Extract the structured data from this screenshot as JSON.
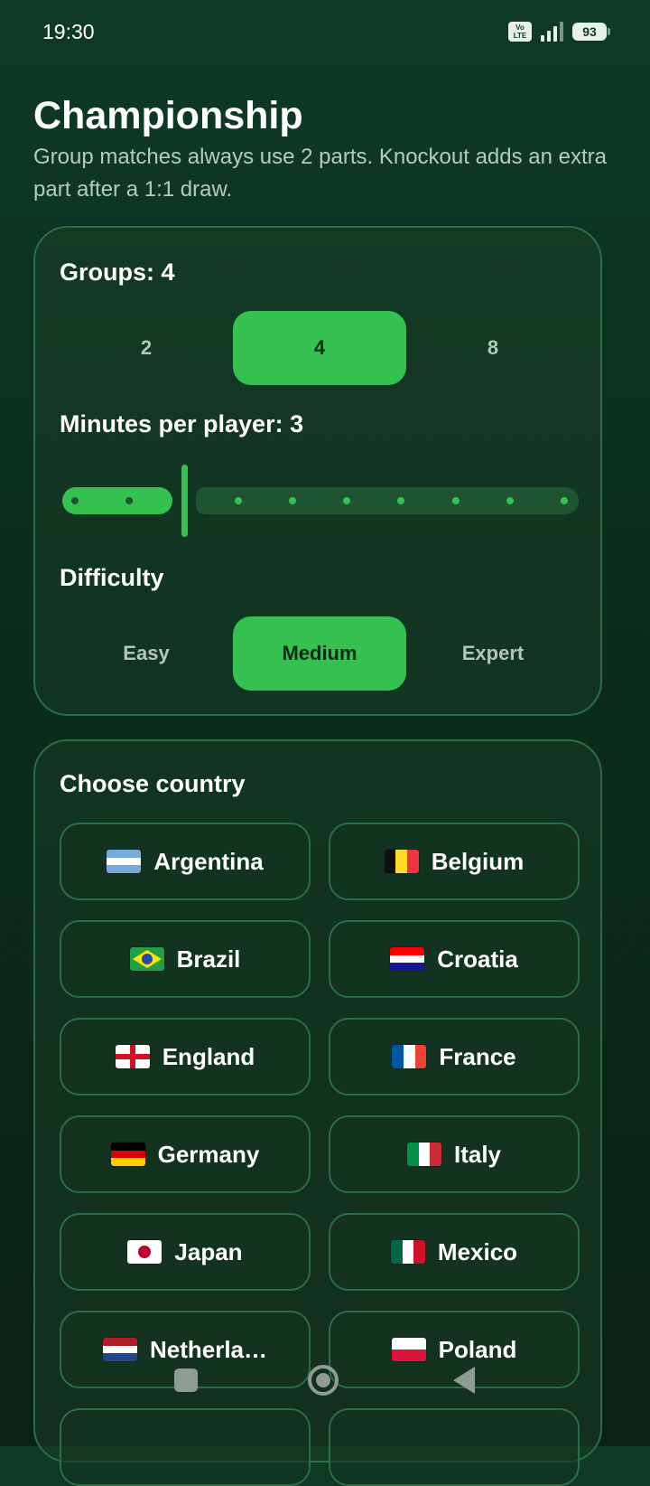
{
  "status_bar": {
    "time": "19:30",
    "network_badge": "Vo LTE",
    "battery": "93"
  },
  "header": {
    "title": "Championship",
    "subtitle": "Group matches always use 2 parts. Knockout adds an extra part after a 1:1 draw."
  },
  "settings": {
    "groups_label": "Groups: 4",
    "groups_options": [
      "2",
      "4",
      "8"
    ],
    "groups_selected": "4",
    "minutes_label": "Minutes per player: 3",
    "minutes_value": 3,
    "minutes_min": 1,
    "minutes_max": 10,
    "difficulty_label": "Difficulty",
    "difficulty_options": [
      "Easy",
      "Medium",
      "Expert"
    ],
    "difficulty_selected": "Medium"
  },
  "country": {
    "label": "Choose country",
    "items": [
      {
        "name": "Argentina",
        "flag": "flag-argentina"
      },
      {
        "name": "Belgium",
        "flag": "flag-belgium"
      },
      {
        "name": "Brazil",
        "flag": "flag-brazil"
      },
      {
        "name": "Croatia",
        "flag": "flag-croatia"
      },
      {
        "name": "England",
        "flag": "flag-england"
      },
      {
        "name": "France",
        "flag": "flag-france"
      },
      {
        "name": "Germany",
        "flag": "flag-germany"
      },
      {
        "name": "Italy",
        "flag": "flag-italy"
      },
      {
        "name": "Japan",
        "flag": "flag-japan"
      },
      {
        "name": "Mexico",
        "flag": "flag-mexico"
      },
      {
        "name": "Netherla…",
        "flag": "flag-netherlands"
      },
      {
        "name": "Poland",
        "flag": "flag-poland"
      }
    ]
  },
  "colors": {
    "accent": "#35c150",
    "background": "#0f3a27",
    "card_border": "#2b6e45"
  }
}
